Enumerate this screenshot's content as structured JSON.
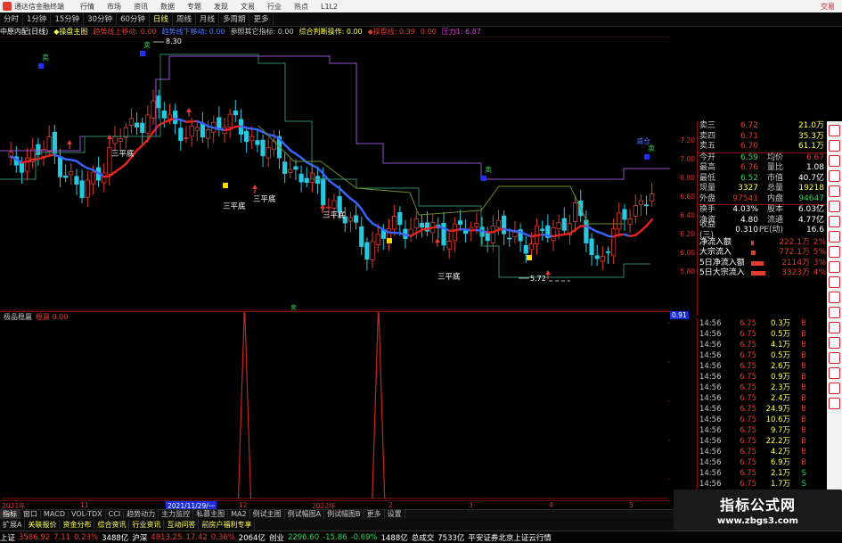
{
  "titlebar": {
    "app_name": "通达信金融终端",
    "menus": [
      "行情",
      "市场",
      "资讯",
      "数据",
      "专题",
      "发现",
      "文易",
      "行业",
      "热点",
      "L1L2"
    ],
    "trade_label": "交易"
  },
  "periods": [
    "分时",
    "1分钟",
    "15分钟",
    "30分钟",
    "60分钟",
    "日线",
    "周线",
    "月线",
    "多周期",
    "更多"
  ],
  "active_period": "日线",
  "indicator_row": {
    "stock": "中原内配(日线)",
    "formula": "◆操盘主图",
    "items": [
      {
        "text": "趋势线上移动: 0.00",
        "color": "#e23b2f"
      },
      {
        "text": "趋势线下移动: 0.00",
        "color": "#4f7bff"
      },
      {
        "text": "参照其它指标: 0.00",
        "color": "#c8c8c8"
      },
      {
        "text": "综合判断操作: 0.00",
        "color": "#ffff55"
      },
      {
        "text": "◆操盘线: 0.39",
        "color": "#e23b2f"
      },
      {
        "text": "0.00",
        "color": "#e23b2f"
      },
      {
        "text": "压力1: 6.87",
        "color": "#e040e0"
      }
    ]
  },
  "chart_annotations": {
    "high_label": "8.30",
    "low_label": "5.72",
    "buy_label": "买",
    "sell_label": "卖",
    "reduce_label": "减仓",
    "pattern_label": "三平底"
  },
  "price_scale": [
    "7.20",
    "7.00",
    "6.80",
    "6.60",
    "6.40",
    "6.20",
    "6.00",
    "5.80"
  ],
  "quote": {
    "top_rows": [
      {
        "label": "卖三",
        "value": "6.72",
        "value2": "21.0万"
      },
      {
        "label": "卖四",
        "value": "6.71",
        "value2": "35.3万"
      },
      {
        "label": "卖五",
        "value": "6.70",
        "value2": "61.1万"
      }
    ],
    "stats": [
      {
        "l1": "今开",
        "v1": "6.59",
        "c1": "#2fd35a",
        "l2": "均价",
        "v2": "6.67",
        "c2": "#e23b2f"
      },
      {
        "l1": "最高",
        "v1": "6.76",
        "c1": "#e23b2f",
        "l2": "量比",
        "v2": "1.08",
        "c2": "#ffffff"
      },
      {
        "l1": "最低",
        "v1": "6.52",
        "c1": "#2fd35a",
        "l2": "市值",
        "v2": "40.7亿",
        "c2": "#ffffff"
      },
      {
        "l1": "现量",
        "v1": "3327",
        "c1": "#ffff55",
        "l2": "总量",
        "v2": "19218",
        "c2": "#ffff55"
      },
      {
        "l1": "外盘",
        "v1": "97541",
        "c1": "#e23b2f",
        "l2": "内盘",
        "v2": "94647",
        "c2": "#2fd35a"
      },
      {
        "l1": "换手",
        "v1": "4.03%",
        "c1": "#ffffff",
        "l2": "股本",
        "v2": "6.03亿",
        "c2": "#ffffff"
      },
      {
        "l1": "净资",
        "v1": "4.80",
        "c1": "#ffffff",
        "l2": "流通",
        "v2": "4.77亿",
        "c2": "#ffffff"
      },
      {
        "l1": "收益(三)",
        "v1": "0.310",
        "c1": "#ffffff",
        "l2": "PE(动)",
        "v2": "16.6",
        "c2": "#ffffff"
      }
    ],
    "flows": [
      {
        "label": "净流入额",
        "bar": 3,
        "value": "222.1万",
        "pct": "2%"
      },
      {
        "label": "大宗流入",
        "bar": 5,
        "value": "772.1万",
        "pct": "5%"
      },
      {
        "label": "5日净流入额",
        "bar": 14,
        "value": "2114万",
        "pct": "3%"
      },
      {
        "label": "5日大宗流入",
        "bar": 16,
        "value": "3323万",
        "pct": "4%"
      }
    ]
  },
  "sub_indicator": {
    "name": "极品稳赢",
    "badge": "稳赢 0.00",
    "scale_label": "0.91"
  },
  "ticks": [
    {
      "time": "14:56",
      "price": "6.75",
      "vol": "0.3万",
      "dir": "B"
    },
    {
      "time": "14:56",
      "price": "6.75",
      "vol": "0.5万",
      "dir": "B"
    },
    {
      "time": "14:56",
      "price": "6.75",
      "vol": "4.1万",
      "dir": "B"
    },
    {
      "time": "14:56",
      "price": "6.75",
      "vol": "0.5万",
      "dir": "B"
    },
    {
      "time": "14:56",
      "price": "6.75",
      "vol": "2.6万",
      "dir": "B"
    },
    {
      "time": "14:56",
      "price": "6.75",
      "vol": "0.9万",
      "dir": "B"
    },
    {
      "time": "14:56",
      "price": "6.75",
      "vol": "2.3万",
      "dir": "B"
    },
    {
      "time": "14:56",
      "price": "6.75",
      "vol": "2.4万",
      "dir": "B"
    },
    {
      "time": "14:56",
      "price": "6.75",
      "vol": "24.9万",
      "dir": "B"
    },
    {
      "time": "14:56",
      "price": "6.75",
      "vol": "10.6万",
      "dir": "B"
    },
    {
      "time": "14:56",
      "price": "6.75",
      "vol": "9.7万",
      "dir": "B"
    },
    {
      "time": "14:56",
      "price": "6.75",
      "vol": "22.2万",
      "dir": "B"
    },
    {
      "time": "14:56",
      "price": "6.75",
      "vol": "4.2万",
      "dir": "B"
    },
    {
      "time": "14:56",
      "price": "6.75",
      "vol": "6.9万",
      "dir": "B"
    },
    {
      "time": "14:56",
      "price": "6.75",
      "vol": "2.1万",
      "dir": "S"
    },
    {
      "time": "14:56",
      "price": "6.75",
      "vol": "1.7万",
      "dir": "S"
    },
    {
      "time": "14:56",
      "price": "6.75",
      "vol": "2.1万",
      "dir": "S"
    }
  ],
  "date_axis": {
    "labels": [
      "2021年",
      "11",
      "12",
      "2022年",
      "2",
      "3",
      "4",
      "5"
    ],
    "highlight": "2021/11/29/一"
  },
  "tabs_row1": [
    "指标",
    "窗口",
    "MACD",
    "VOL-TDX",
    "CCI",
    "趋势动力",
    "主力监控",
    "私募主图",
    "MA2",
    "例试主图",
    "例试幅图A",
    "例试幅图B",
    "更多",
    "设置"
  ],
  "tabs_row2": [
    "扩展A",
    "关联报价",
    "资金分布",
    "综合资讯",
    "行业资讯",
    "互动问答",
    "前房户福利专享"
  ],
  "statusbar": {
    "items": [
      {
        "text": "上证",
        "color": "#ffffff"
      },
      {
        "text": "3586.92",
        "color": "#e23b2f"
      },
      {
        "text": "7.11",
        "color": "#e23b2f"
      },
      {
        "text": "0.23%",
        "color": "#e23b2f"
      },
      {
        "text": "3488亿",
        "color": "#ffffff"
      },
      {
        "text": "沪深",
        "color": "#ffffff"
      },
      {
        "text": "4813.25",
        "color": "#e23b2f"
      },
      {
        "text": "17.42",
        "color": "#e23b2f"
      },
      {
        "text": "0.36%",
        "color": "#e23b2f"
      },
      {
        "text": "2064亿",
        "color": "#ffffff"
      },
      {
        "text": "创业",
        "color": "#ffffff"
      },
      {
        "text": "2296.60",
        "color": "#2fd35a"
      },
      {
        "text": "-15.86",
        "color": "#2fd35a"
      },
      {
        "text": "-0.69%",
        "color": "#2fd35a"
      },
      {
        "text": "1488亿",
        "color": "#ffffff"
      },
      {
        "text": "总成交",
        "color": "#ffffff"
      },
      {
        "text": "7533亿",
        "color": "#ffffff"
      },
      {
        "text": "平安证券北京上证云行情",
        "color": "#ffffff"
      }
    ]
  },
  "watermark": {
    "title": "指标公式网",
    "url": "www.zbgs3.com"
  }
}
